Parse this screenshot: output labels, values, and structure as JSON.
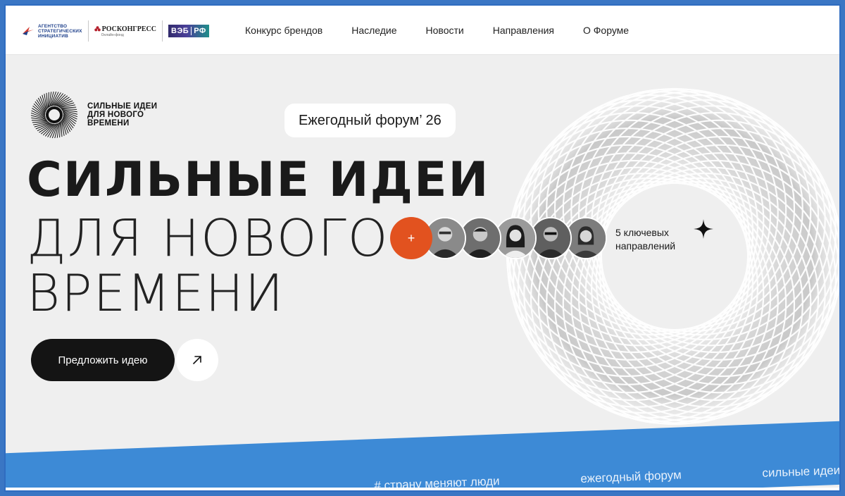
{
  "header": {
    "logos": {
      "asi": [
        "АГЕНТСТВО",
        "СТРАТЕГИЧЕСКИХ",
        "ИНИЦИАТИВ"
      ],
      "roscongress": "РОСКОНГРЕСС",
      "roscongress_sub": "Онлайн-фонд",
      "veb_left": "ВЭБ",
      "veb_right": "РФ"
    },
    "nav": [
      {
        "label": "Конкурс брендов"
      },
      {
        "label": "Наследие"
      },
      {
        "label": "Новости"
      },
      {
        "label": "Направления"
      },
      {
        "label": "О Форуме"
      }
    ]
  },
  "hero": {
    "brand_lines": [
      "СИЛЬНЫЕ ИДЕИ",
      "ДЛЯ НОВОГО",
      "ВРЕМЕНИ"
    ],
    "forum_pill": "Ежегодный форум’ 26",
    "title_line1": "СИЛЬНЫЕ ИДЕИ",
    "title_line2": "ДЛЯ НОВОГО",
    "title_line3": "ВРЕМЕНИ",
    "cta_label": "Предложить идею",
    "plus_label": "+",
    "directions_lines": [
      "5 ключевых",
      "направлений"
    ]
  },
  "ribbon": {
    "items": [
      "# страну меняют люди",
      "ежегодный форум",
      "сильные идеи"
    ]
  },
  "colors": {
    "accent_orange": "#e2521f",
    "ribbon_blue": "#3d8ad6",
    "page_bg": "#efefef",
    "frame_border": "#2f6cc0"
  },
  "icons": {
    "cta_arrow": "arrow-up-right-icon",
    "sparkle": "sparkle-star-icon"
  }
}
